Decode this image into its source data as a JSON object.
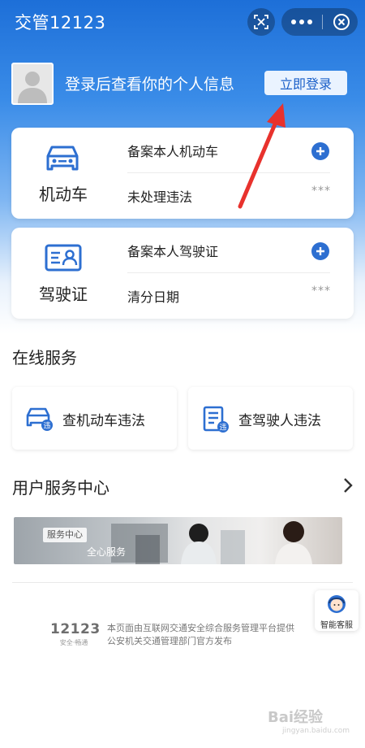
{
  "app": {
    "title": "交管12123"
  },
  "login": {
    "prompt": "登录后查看你的个人信息",
    "button": "立即登录"
  },
  "vehicle_card": {
    "label": "机动车",
    "row1": "备案本人机动车",
    "row2": "未处理违法",
    "masked": "***"
  },
  "license_card": {
    "label": "驾驶证",
    "row1": "备案本人驾驶证",
    "row2": "清分日期",
    "masked": "***"
  },
  "online_services": {
    "title": "在线服务",
    "items": [
      {
        "label": "查机动车违法",
        "icon": "car-violation-icon"
      },
      {
        "label": "查驾驶人违法",
        "icon": "driver-violation-icon"
      }
    ]
  },
  "user_center": {
    "title": "用户服务中心",
    "banner_tag": "服务中心",
    "banner_text": "全心服务"
  },
  "customer_service": {
    "label": "智能客服"
  },
  "footer": {
    "logo": "12123",
    "slogan": "安全·畅通",
    "line1": "本页面由互联网交通安全综合服务管理平台提供",
    "line2": "公安机关交通管理部门官方发布"
  },
  "watermark": {
    "text": "Bai经验",
    "sub": "jingyan.baidu.com"
  },
  "colors": {
    "primary": "#2d6fd1",
    "header": "#1d6fd8",
    "annotation_arrow": "#e8322d"
  }
}
